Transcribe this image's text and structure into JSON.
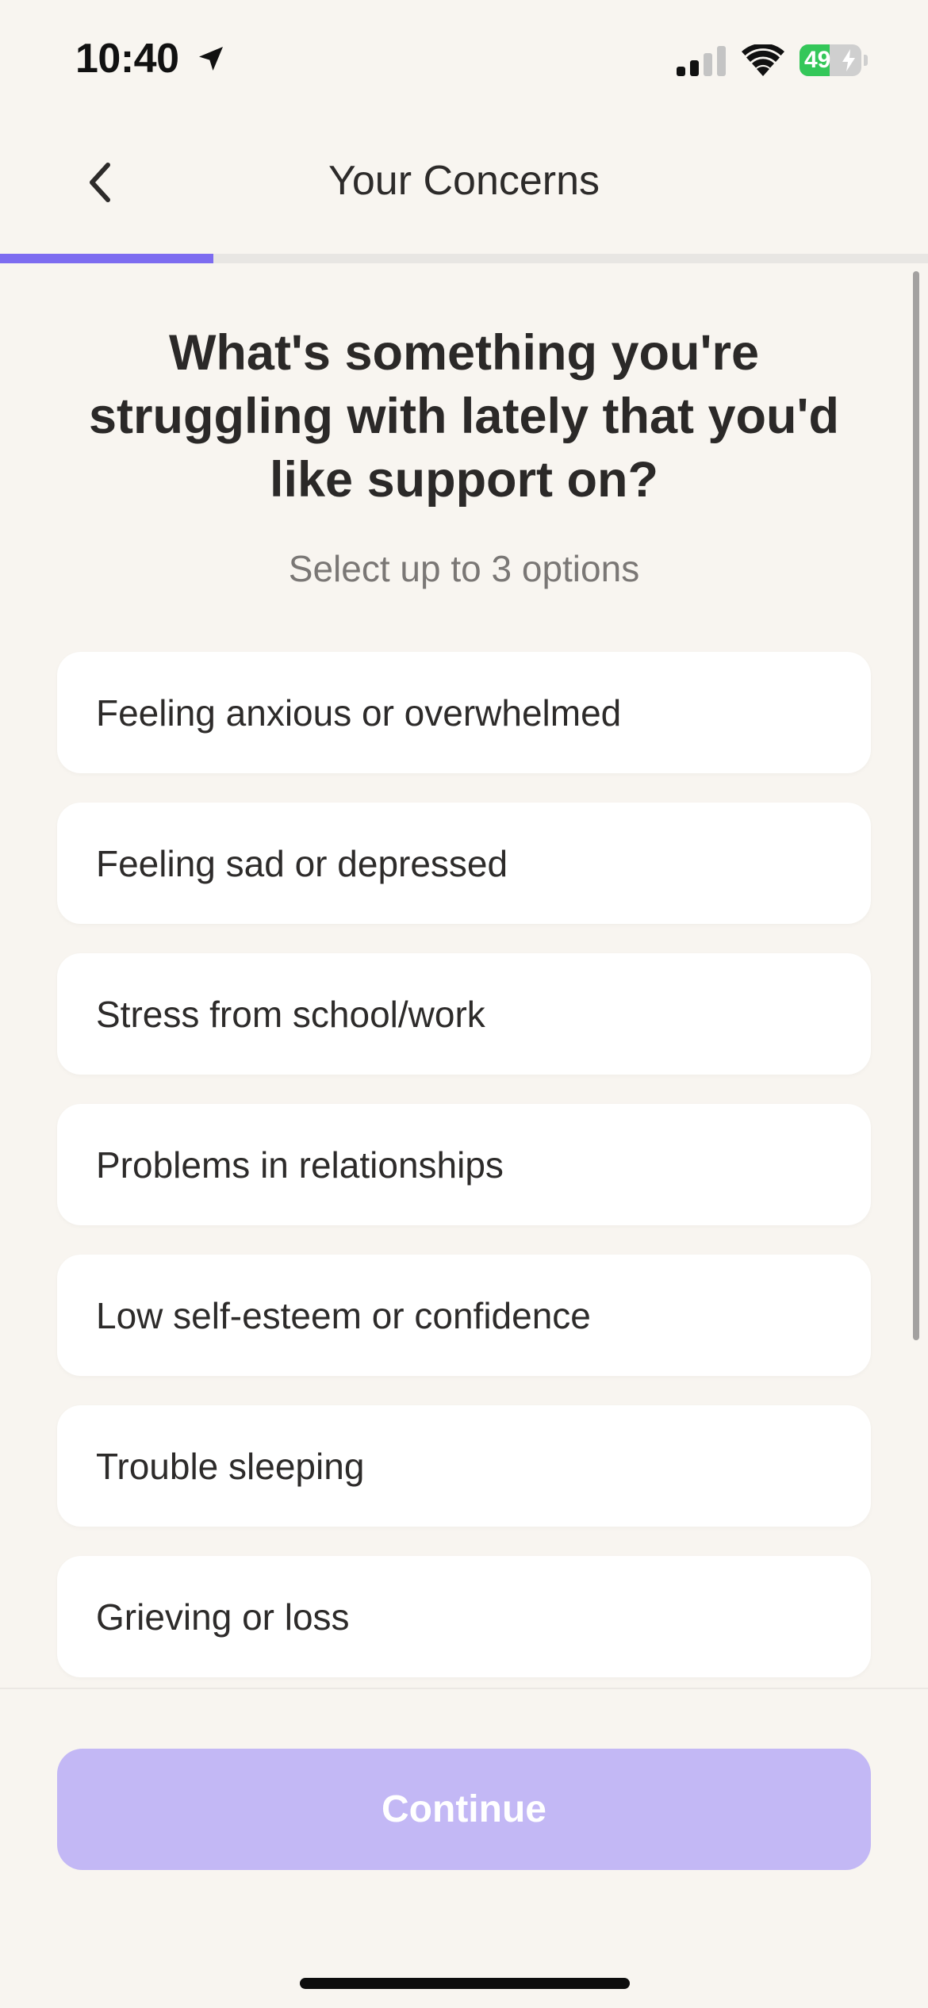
{
  "status_bar": {
    "time": "10:40",
    "battery_level": "49",
    "battery_fraction": 0.49,
    "icons": [
      "location-arrow-icon",
      "cellular-signal-icon",
      "wifi-icon",
      "battery-charging-icon"
    ]
  },
  "header": {
    "title": "Your Concerns",
    "back_icon": "chevron-left-icon"
  },
  "progress": {
    "fraction": 0.23,
    "color": "#7d6cf0"
  },
  "question": {
    "title": "What's something you're struggling with lately that you'd like support on?",
    "subtitle": "Select up to 3 options"
  },
  "options": [
    {
      "label": "Feeling anxious or overwhelmed"
    },
    {
      "label": "Feeling sad or depressed"
    },
    {
      "label": "Stress from school/work"
    },
    {
      "label": "Problems in relationships"
    },
    {
      "label": "Low self-esteem or confidence"
    },
    {
      "label": "Trouble sleeping"
    },
    {
      "label": "Grieving or loss"
    }
  ],
  "footer": {
    "continue_label": "Continue",
    "continue_color": "#c3b8f5"
  }
}
